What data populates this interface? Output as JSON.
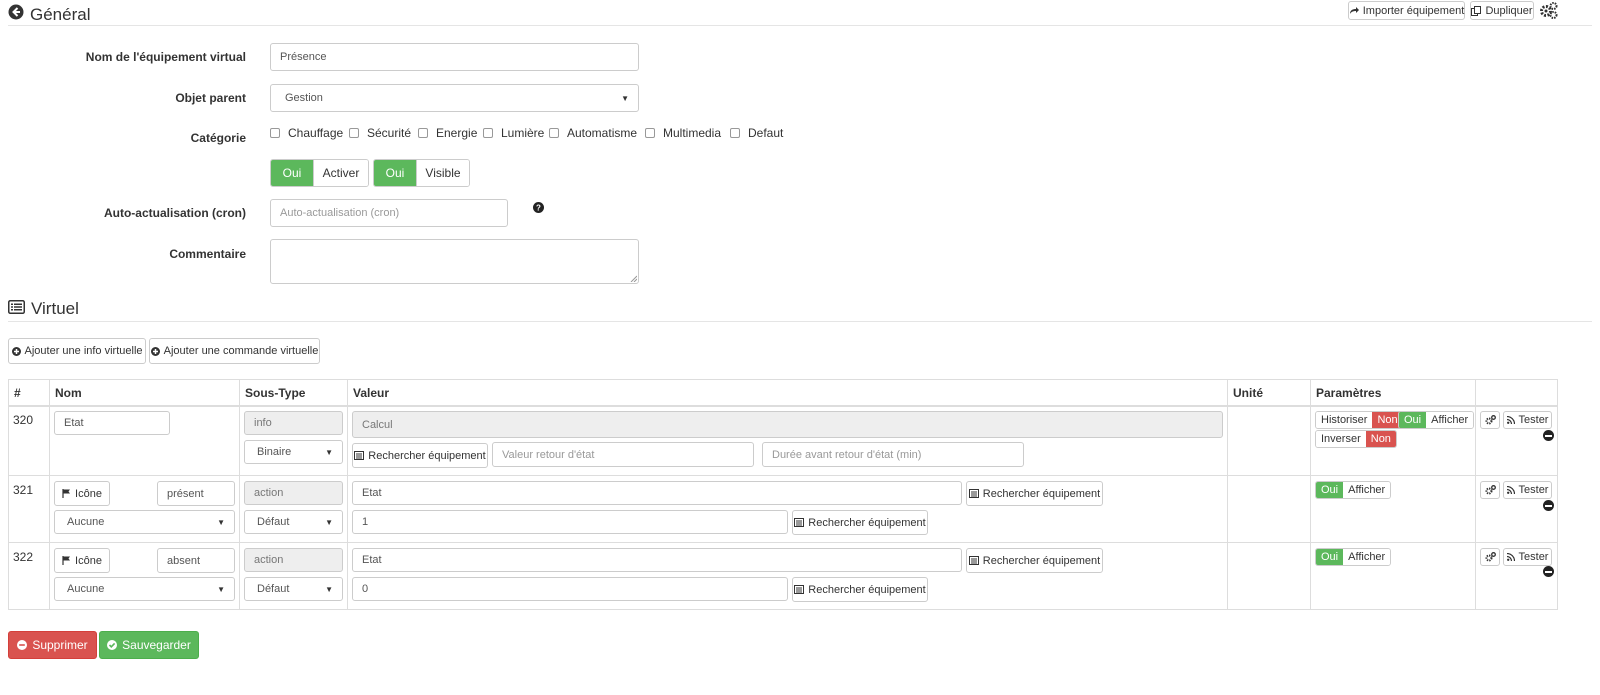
{
  "general": {
    "title": "Général",
    "import_label": "Importer équipement",
    "duplicate_label": "Dupliquer"
  },
  "form": {
    "name_label": "Nom de l'équipement virtual",
    "name_value": "Présence",
    "parent_label": "Objet parent",
    "parent_value": "Gestion",
    "category_label": "Catégorie",
    "categories": [
      "Chauffage",
      "Sécurité",
      "Energie",
      "Lumière",
      "Automatisme",
      "Multimedia",
      "Defaut"
    ],
    "enable_yes": "Oui",
    "enable_label": "Activer",
    "visible_yes": "Oui",
    "visible_label": "Visible",
    "cron_label": "Auto-actualisation (cron)",
    "cron_placeholder": "Auto-actualisation (cron)",
    "comment_label": "Commentaire"
  },
  "virtual": {
    "title": "Virtuel",
    "add_info_label": "Ajouter une info virtuelle",
    "add_cmd_label": "Ajouter une commande virtuelle"
  },
  "table": {
    "headers": [
      "#",
      "Nom",
      "Sous-Type",
      "Valeur",
      "Unité",
      "Paramètres"
    ],
    "rows": [
      {
        "id": "320",
        "name": "Etat",
        "type": "info",
        "subtype": "Binaire",
        "value_placeholder": "Calcul",
        "search_label": "Rechercher équipement",
        "return_value_placeholder": "Valeur retour d'état",
        "return_delay_placeholder": "Durée avant retour d'état (min)",
        "historize_label": "Historiser",
        "historize_value": "Non",
        "display_yes": "Oui",
        "display_label": "Afficher",
        "invert_label": "Inverser",
        "invert_value": "Non",
        "test_label": "Tester"
      },
      {
        "id": "321",
        "icon_label": "Icône",
        "name": "présent",
        "type": "action",
        "icon_select": "Aucune",
        "subtype": "Défaut",
        "value": "Etat",
        "value2": "1",
        "search_label": "Rechercher équipement",
        "search_label2": "Rechercher équipement",
        "display_yes": "Oui",
        "display_label": "Afficher",
        "test_label": "Tester"
      },
      {
        "id": "322",
        "icon_label": "Icône",
        "name": "absent",
        "type": "action",
        "icon_select": "Aucune",
        "subtype": "Défaut",
        "value": "Etat",
        "value2": "0",
        "search_label": "Rechercher équipement",
        "search_label2": "Rechercher équipement",
        "display_yes": "Oui",
        "display_label": "Afficher",
        "test_label": "Tester"
      }
    ]
  },
  "actions": {
    "delete_label": "Supprimer",
    "save_label": "Sauvegarder"
  },
  "colors": {
    "success": "#5cb85c",
    "danger": "#d9534f",
    "border": "#cccccc",
    "disabled_bg": "#eeeeee"
  }
}
